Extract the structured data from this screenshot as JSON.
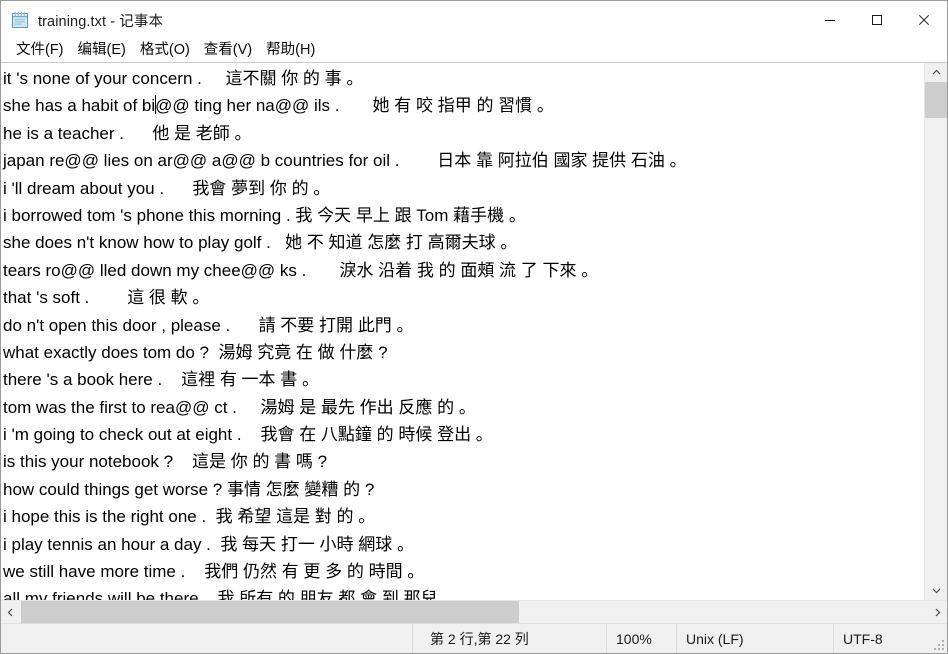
{
  "window": {
    "title": "training.txt - 记事本",
    "icon": "notepad-icon",
    "minimize_label": "—",
    "maximize_label": "□",
    "close_label": "✕"
  },
  "menu": {
    "items": [
      {
        "label": "文件(F)"
      },
      {
        "label": "编辑(E)"
      },
      {
        "label": "格式(O)"
      },
      {
        "label": "查看(V)"
      },
      {
        "label": "帮助(H)"
      }
    ]
  },
  "editor": {
    "lines": [
      {
        "en": "it 's none of your concern .",
        "gap": "     ",
        "zh": "這不關 你 的 事 。"
      },
      {
        "en": "she has a habit of bi",
        "caret": true,
        "en2": "@@ ting her na@@ ils .",
        "gap": "       ",
        "zh": "她 有 咬 指甲 的 習慣 。"
      },
      {
        "en": "he is a teacher .",
        "gap": "      ",
        "zh": "他 是 老師 。"
      },
      {
        "en": "japan re@@ lies on ar@@ a@@ b countries for oil .",
        "gap": "        ",
        "zh": "日本 靠 阿拉伯 國家 提供 石油 。"
      },
      {
        "en": "i 'll dream about you .",
        "gap": "      ",
        "zh": "我會 夢到 你 的 。"
      },
      {
        "en": "i borrowed tom 's phone this morning .",
        "gap": " ",
        "zh": "我 今天 早上 跟 Tom 藉手機 。"
      },
      {
        "en": "she does n't know how to play golf .",
        "gap": "   ",
        "zh": "她 不 知道 怎麼 打 高爾夫球 。"
      },
      {
        "en": "tears ro@@ lled down my chee@@ ks .",
        "gap": "       ",
        "zh": "淚水 沿着 我 的 面頰 流 了 下來 。"
      },
      {
        "en": "that 's soft .",
        "gap": "        ",
        "zh": "這 很 軟 。"
      },
      {
        "en": "do n't open this door , please .",
        "gap": "      ",
        "zh": "請 不要 打開 此門 。"
      },
      {
        "en": "what exactly does tom do ?",
        "gap": "  ",
        "zh": "湯姆 究竟 在 做 什麼 ?"
      },
      {
        "en": "there 's a book here .",
        "gap": "    ",
        "zh": "這裡 有 一本 書 。"
      },
      {
        "en": "tom was the first to rea@@ ct .",
        "gap": "     ",
        "zh": "湯姆 是 最先 作出 反應 的 。"
      },
      {
        "en": "i 'm going to check out at eight .",
        "gap": "    ",
        "zh": "我會 在 八點鐘 的 時候 登出 。"
      },
      {
        "en": "is this your notebook ?",
        "gap": "    ",
        "zh": "這是 你 的 書 嗎 ?"
      },
      {
        "en": "how could things get worse ?",
        "gap": " ",
        "zh": "事情 怎麼 變糟 的 ?"
      },
      {
        "en": "i hope this is the right one .",
        "gap": "  ",
        "zh": "我 希望 這是 對 的 。"
      },
      {
        "en": "i play tennis an hour a day .",
        "gap": "  ",
        "zh": "我 每天 打一 小時 網球 。"
      },
      {
        "en": "we still have more time .",
        "gap": "    ",
        "zh": "我們 仍然 有 更 多 的 時間 。"
      },
      {
        "en": "all my friends will be there .",
        "gap": "  ",
        "zh": "我 所有 的 朋友 都 會 到 那兒 。"
      }
    ]
  },
  "scrollbars": {
    "vertical": {
      "up_icon": "chevron-up-icon",
      "down_icon": "chevron-down-icon"
    },
    "horizontal": {
      "left_icon": "chevron-left-icon",
      "right_icon": "chevron-right-icon"
    }
  },
  "statusbar": {
    "position": "第 2 行,第 22 列",
    "zoom": "100%",
    "line_ending": "Unix (LF)",
    "encoding": "UTF-8"
  }
}
